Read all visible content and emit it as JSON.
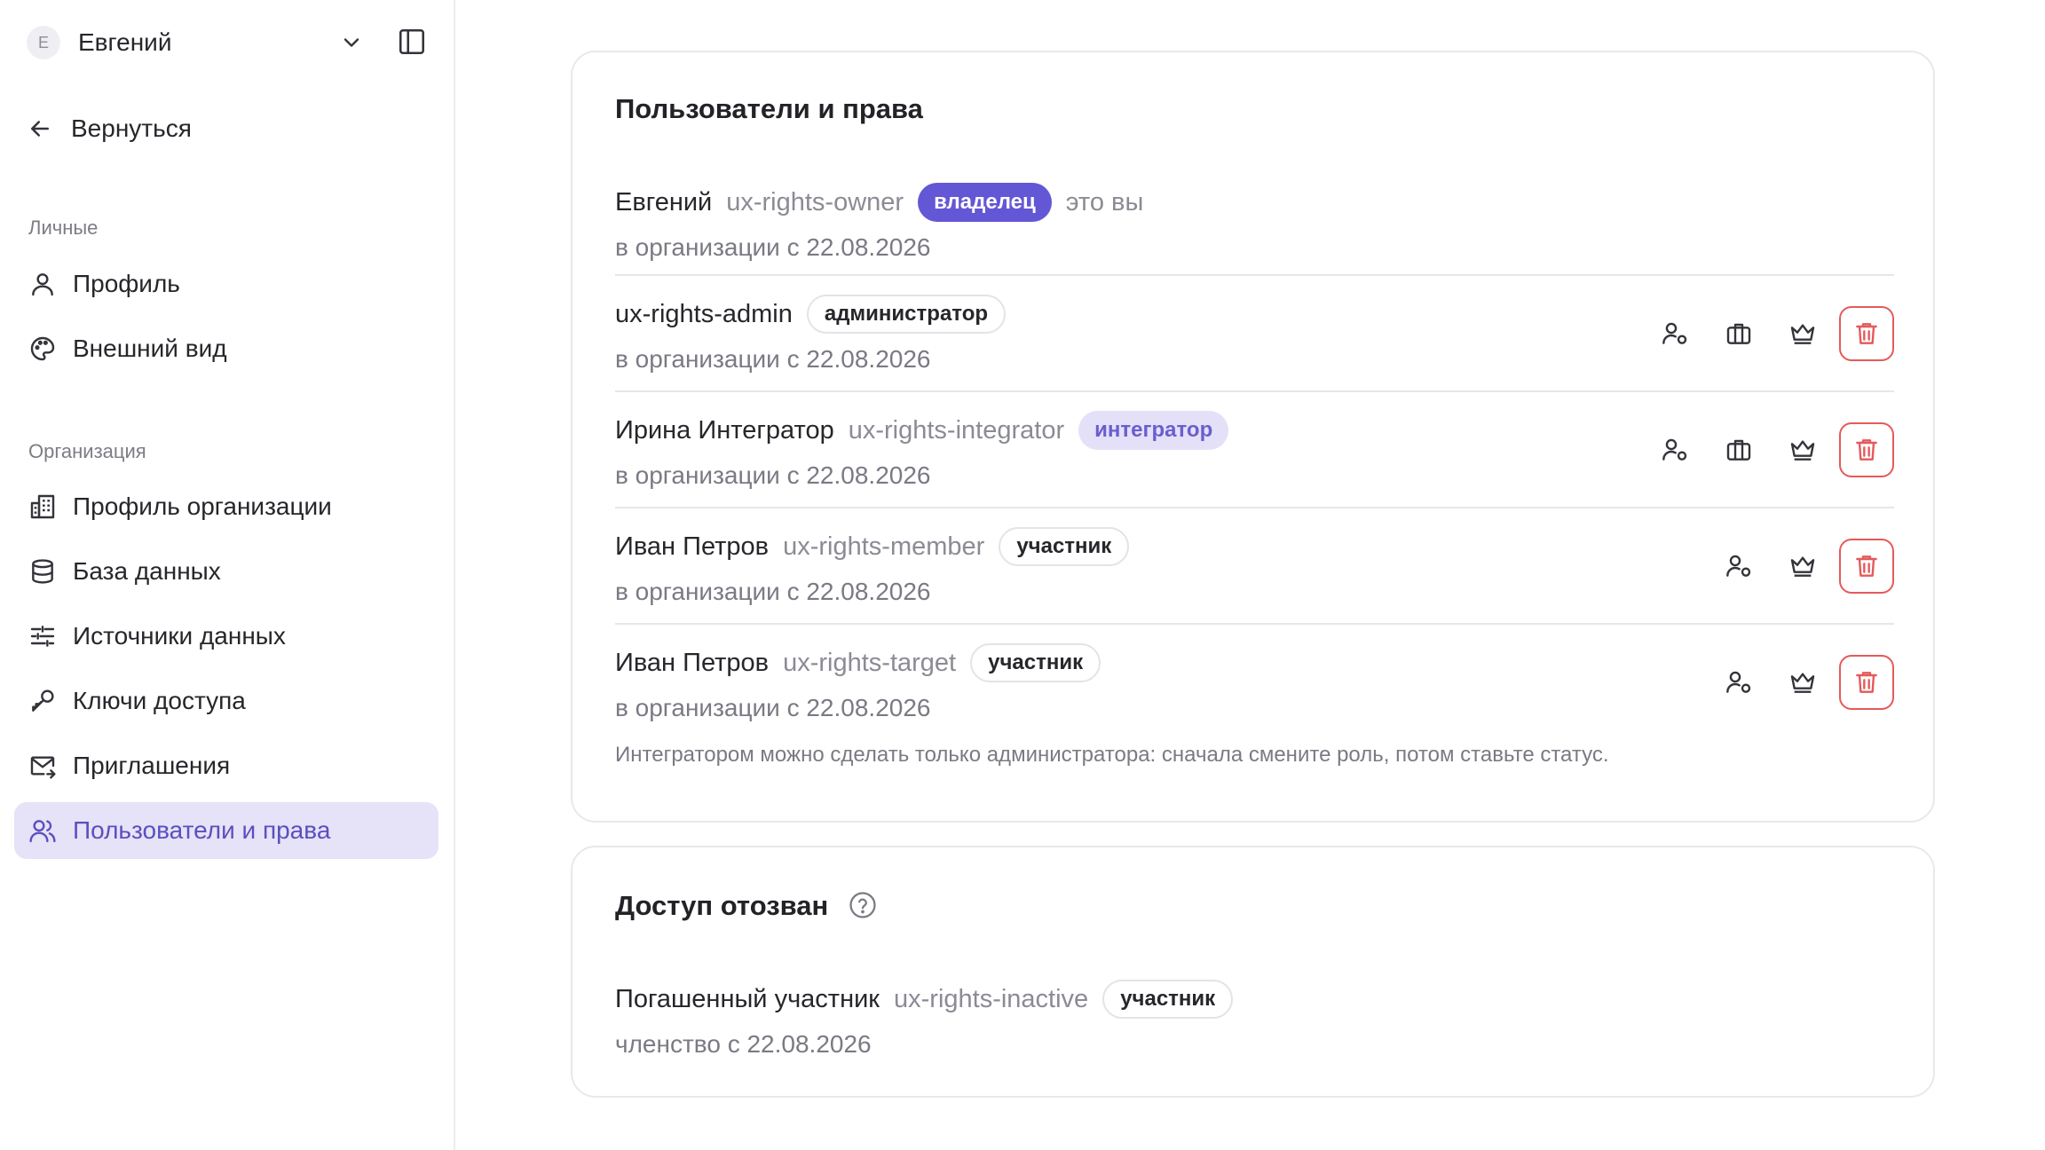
{
  "sidebar": {
    "user": {
      "initial": "Е",
      "name": "Евгений"
    },
    "back_label": "Вернуться",
    "sections": [
      {
        "label": "Личные"
      },
      {
        "label": "Организация"
      }
    ],
    "items": [
      {
        "label": "Профиль",
        "icon": "user-icon"
      },
      {
        "label": "Внешний вид",
        "icon": "palette-icon"
      },
      {
        "label": "Профиль организации",
        "icon": "building-icon"
      },
      {
        "label": "База данных",
        "icon": "database-icon"
      },
      {
        "label": "Источники данных",
        "icon": "sliders-icon"
      },
      {
        "label": "Ключи доступа",
        "icon": "key-icon"
      },
      {
        "label": "Приглашения",
        "icon": "mail-icon"
      },
      {
        "label": "Пользователи и права",
        "icon": "users-icon",
        "active": true
      }
    ]
  },
  "users_card": {
    "title": "Пользователи и права",
    "rows": [
      {
        "name": "Евгений",
        "login": "ux-rights-owner",
        "badge": "владелец",
        "self": "это вы",
        "since": "в организации с 22.08.2026"
      },
      {
        "name": "ux-rights-admin",
        "login": "",
        "badge": "администратор",
        "since": "в организации с 22.08.2026"
      },
      {
        "name": "Ирина Интегратор",
        "login": "ux-rights-integrator",
        "badge": "интегратор",
        "since": "в организации с 22.08.2026"
      },
      {
        "name": "Иван Петров",
        "login": "ux-rights-member",
        "badge": "участник",
        "since": "в организации с 22.08.2026"
      },
      {
        "name": "Иван Петров",
        "login": "ux-rights-target",
        "badge": "участник",
        "since": "в организации с 22.08.2026"
      }
    ],
    "hint": "Интегратором можно сделать только администратора: сначала смените роль, потом ставьте статус."
  },
  "revoked_card": {
    "title": "Доступ отозван",
    "row": {
      "name": "Погашенный участник",
      "login": "ux-rights-inactive",
      "badge": "участник",
      "since": "членство с 22.08.2026"
    }
  },
  "colors": {
    "accent": "#6357d6",
    "active_nav_bg": "#e6e2f7",
    "danger": "#e55a5a",
    "muted_text": "#7a7a84"
  }
}
